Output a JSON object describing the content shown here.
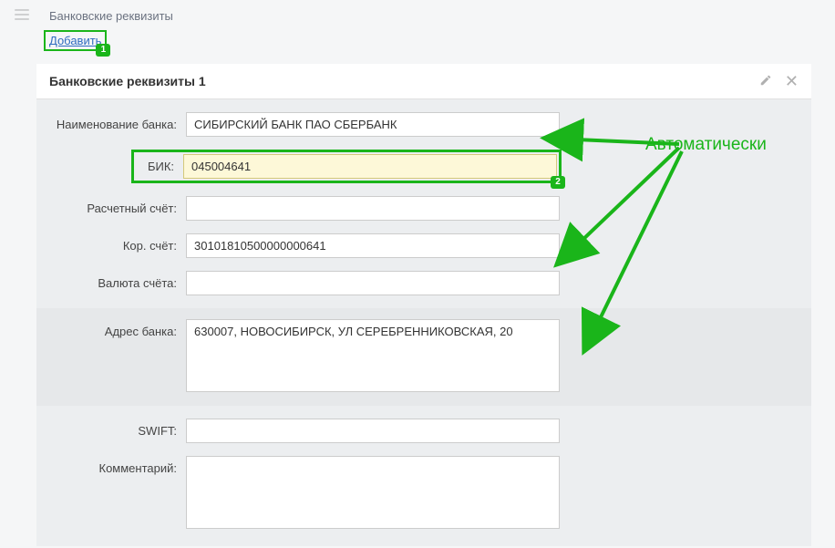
{
  "page": {
    "title": "Банковские реквизиты"
  },
  "add": {
    "label": "Добавить",
    "badge": "1"
  },
  "section": {
    "title": "Банковские реквизиты 1"
  },
  "fields": {
    "bank_name": {
      "label": "Наименование банка:",
      "value": "СИБИРСКИЙ БАНК ПАО СБЕРБАНК"
    },
    "bik": {
      "label": "БИК:",
      "value": "045004641",
      "badge": "2"
    },
    "acct": {
      "label": "Расчетный счёт:",
      "value": ""
    },
    "corr": {
      "label": "Кор. счёт:",
      "value": "30101810500000000641"
    },
    "currency": {
      "label": "Валюта счёта:",
      "value": ""
    },
    "address": {
      "label": "Адрес банка:",
      "value": "630007, НОВОСИБИРСК, УЛ СЕРЕБРЕННИКОВСКАЯ, 20"
    },
    "swift": {
      "label": "SWIFT:",
      "value": ""
    },
    "comment": {
      "label": "Комментарий:",
      "value": ""
    }
  },
  "annotation": {
    "text": "Автоматически"
  }
}
